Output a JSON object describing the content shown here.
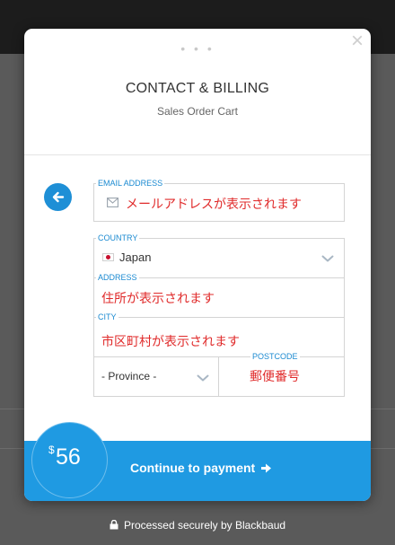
{
  "modal": {
    "dots": "• • •",
    "close_glyph": "×",
    "title": "CONTACT & BILLING",
    "subtitle": "Sales Order Cart"
  },
  "form": {
    "email": {
      "label": "EMAIL ADDRESS",
      "value": "メールアドレスが表示されます"
    },
    "country": {
      "label": "COUNTRY",
      "value": "Japan"
    },
    "address": {
      "label": "ADDRESS",
      "value": "住所が表示されます"
    },
    "city": {
      "label": "CITY",
      "value": "市区町村が表示されます"
    },
    "province": {
      "value": "- Province -"
    },
    "postcode": {
      "label": "POSTCODE",
      "value": "郵便番号"
    }
  },
  "footer": {
    "currency": "$",
    "amount": "56",
    "continue_label": "Continue to payment"
  },
  "secure_text": "Processed securely by Blackbaud",
  "colors": {
    "accent": "#1f9ae2",
    "label_blue": "#1b8ad1",
    "placeholder_red": "#e02b2b",
    "overlay": "#5a5a5a"
  },
  "icons": [
    "back-arrow-icon",
    "mail-icon",
    "japan-flag-icon",
    "chevron-down-icon",
    "arrow-right-icon",
    "lock-icon",
    "close-icon"
  ]
}
